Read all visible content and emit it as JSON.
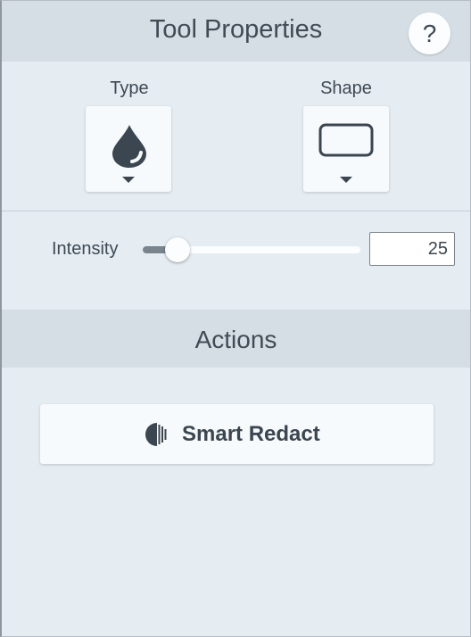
{
  "header": {
    "title": "Tool Properties",
    "help_label": "?"
  },
  "properties": {
    "type": {
      "label": "Type",
      "icon": "drop-icon"
    },
    "shape": {
      "label": "Shape",
      "icon": "rounded-rectangle-icon"
    }
  },
  "intensity": {
    "label": "Intensity",
    "value": "25",
    "fraction": 0.16
  },
  "actions": {
    "title": "Actions",
    "smart_redact": {
      "label": "Smart Redact",
      "icon": "half-circle-redact-icon"
    }
  },
  "colors": {
    "header_bg": "#d5dee5",
    "panel_bg": "#e5edf3",
    "button_bg": "#f7fafc",
    "icon": "#3b4650"
  }
}
